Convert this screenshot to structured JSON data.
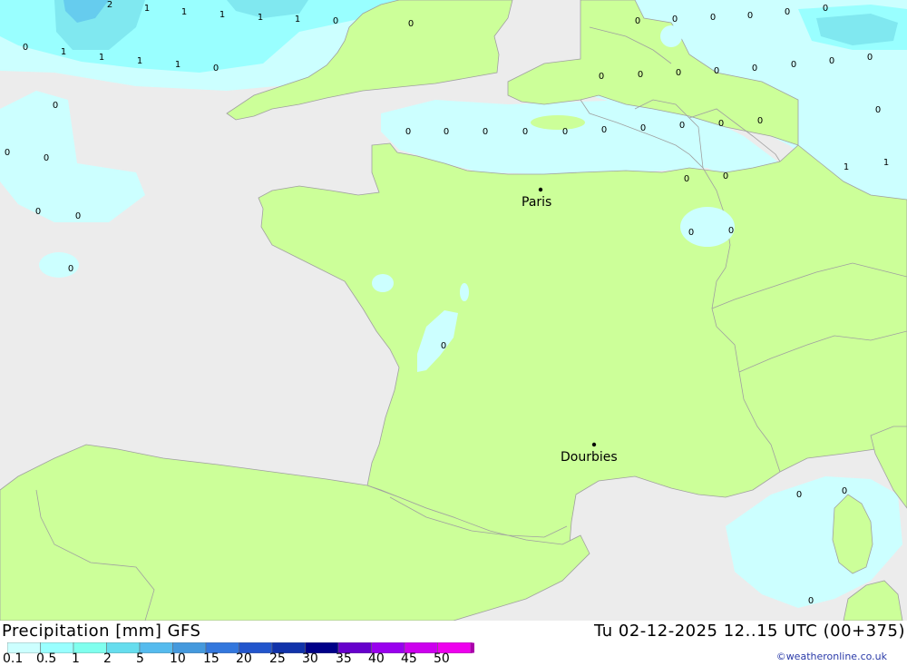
{
  "title": "Precipitation [mm] GFS",
  "valid_time": "Tu 02-12-2025 12..15 UTC (00+375)",
  "credit": "©weatheronline.co.uk",
  "colors": {
    "sea": "#ececec",
    "land": "#ccff99",
    "border": "#a0a0a0",
    "precip_0": "#ccffff",
    "precip_1": "#99ffff",
    "precip_2": "#80e8f0",
    "precip_5": "#66ccee"
  },
  "legend": {
    "ticks": [
      "0.1",
      "0.5",
      "1",
      "2",
      "5",
      "10",
      "15",
      "20",
      "25",
      "30",
      "35",
      "40",
      "45",
      "50"
    ],
    "colors": [
      "#ccffff",
      "#99ffff",
      "#80ffee",
      "#66ddee",
      "#55bbee",
      "#4499dd",
      "#3377dd",
      "#2255cc",
      "#1133aa",
      "#000088",
      "#6600cc",
      "#9900ee",
      "#cc00ee",
      "#ee00ee",
      "#aa00aa"
    ]
  },
  "cities": [
    {
      "name": "Paris"
    },
    {
      "name": "Dourbies"
    }
  ],
  "values": [
    "2",
    "1",
    "1",
    "1",
    "1",
    "1",
    "0",
    "0",
    "0",
    "1",
    "1",
    "1",
    "1",
    "0",
    "0",
    "0",
    "0",
    "0",
    "0",
    "0",
    "0",
    "0",
    "0",
    "0",
    "0",
    "0",
    "0",
    "0",
    "0",
    "0",
    "0",
    "0",
    "0",
    "0",
    "0",
    "0",
    "0",
    "0",
    "0",
    "0",
    "0",
    "0",
    "1",
    "1",
    "0",
    "0",
    "0",
    "0",
    "0",
    "0",
    "0",
    "0",
    "0",
    "0",
    "0",
    "0",
    "0",
    "0",
    "0",
    "0"
  ]
}
